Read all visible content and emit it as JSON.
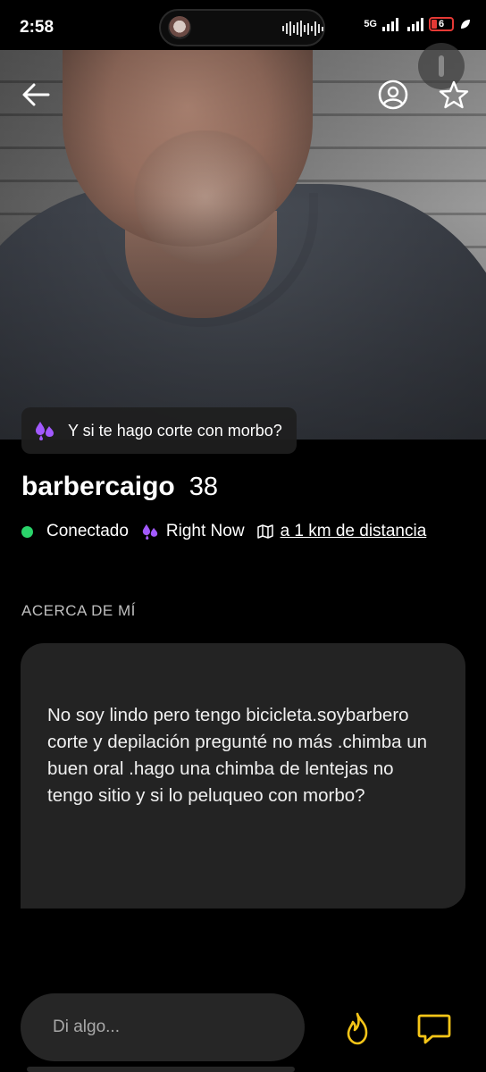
{
  "status_bar": {
    "time": "2:58",
    "network": "5G",
    "battery": "6",
    "colors": {
      "battery_low": "#e53935"
    }
  },
  "profile": {
    "username": "barbercaigo",
    "age": "38",
    "tagline": "Y si te hago corte con morbo?",
    "online_status": "Conectado",
    "right_now": "Right Now",
    "distance": "a 1 km de distancia",
    "colors": {
      "online": "#2ad46a",
      "accent": "#a259ff",
      "action": "#f5c518"
    }
  },
  "about": {
    "section_title": "ACERCA DE MÍ",
    "text": "No soy lindo pero tengo bicicleta.soybarbero corte y depilación pregunté no más .chimba un buen oral .hago una chimba de lentejas no tengo sitio y si lo peluqueo con morbo?"
  },
  "chat": {
    "input_placeholder": "Di algo..."
  },
  "icons": {
    "back": "arrow-left-icon",
    "profile": "user-circle-icon",
    "favorite": "star-icon",
    "right_now": "droplets-icon",
    "map": "map-icon",
    "tap": "fire-icon",
    "chat": "chat-bubble-icon"
  }
}
